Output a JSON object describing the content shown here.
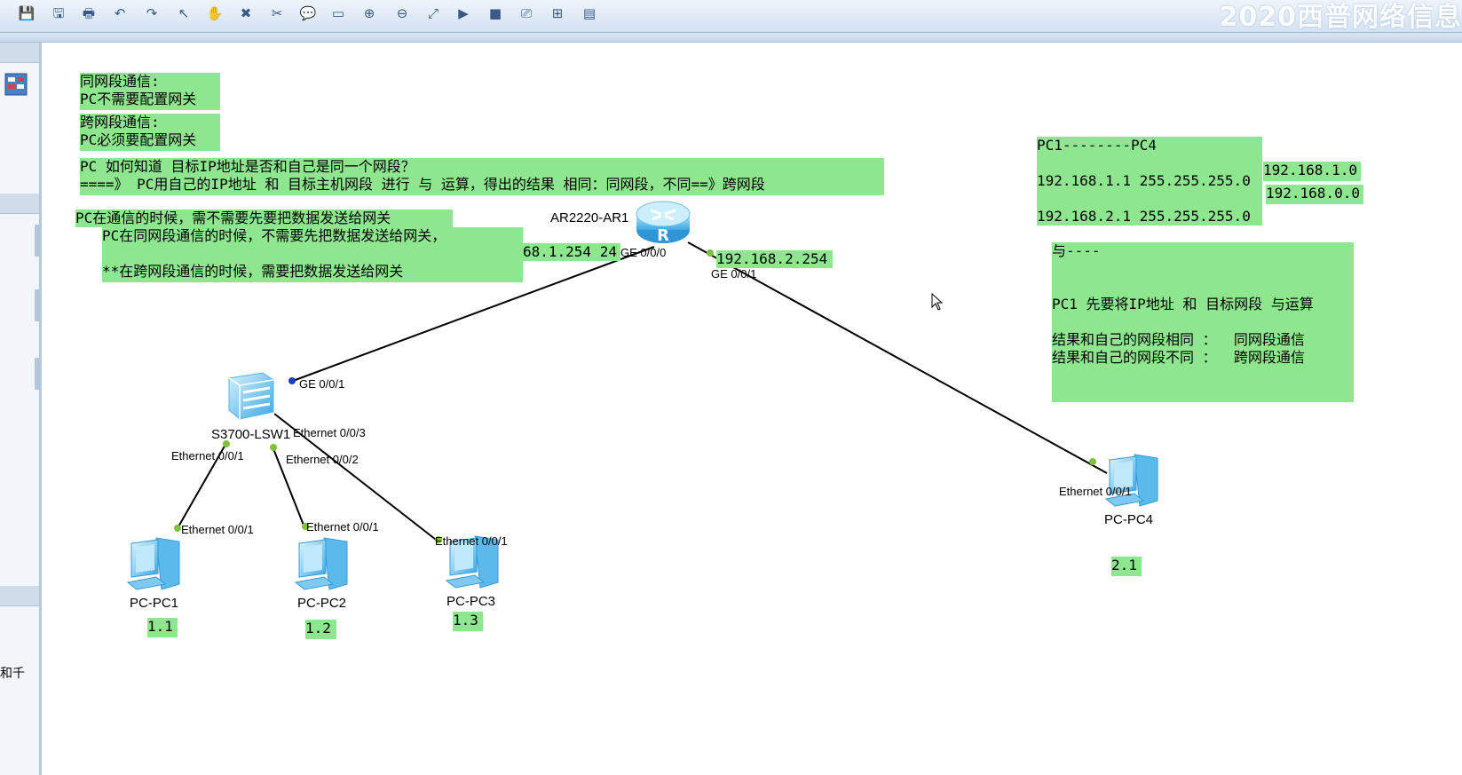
{
  "toolbar": {
    "icons": [
      "save-icon",
      "save-as-icon",
      "print-icon",
      "undo-icon",
      "redo-icon",
      "select-icon",
      "pan-icon",
      "delete-icon",
      "delete-link-icon",
      "text-note-icon",
      "rectangle-icon",
      "zoom-in-icon",
      "zoom-out-icon",
      "fit-icon",
      "start-icon",
      "stop-icon",
      "capture-icon",
      "topology-icon",
      "panel-icon",
      "screenshot-icon"
    ],
    "glyphs": [
      "💾",
      "🖫",
      "🖶",
      "↶",
      "↷",
      "↖",
      "✋",
      "✖",
      "✂",
      "💬",
      "▭",
      "⊕",
      "⊖",
      "⤢",
      "▶",
      "■",
      "⎚",
      "⊞",
      "▤",
      "▣"
    ],
    "brand": "2020西普网络信息"
  },
  "left_panel": {
    "text": "和千"
  },
  "notes": {
    "n1": "同网段通信:\nPC不需要配置网关",
    "n2": "跨网段通信:\nPC必须要配置网关",
    "n3": "PC 如何知道 目标IP地址是否和自己是同一个网段？\n====》 PC用自己的IP地址 和 目标主机网段 进行 与 运算，得出的结果 相同：同网段，不同==》跨网段",
    "n4": "PC在通信的时候，需不需要先要把数据发送给网关",
    "n5": "PC在同网段通信的时候，不需要先把数据发送给网关，\n\n**在跨网段通信的时候，需要把数据发送给网关",
    "n6": "68.1.254 24",
    "n7": "192.168.2.254",
    "n8": "PC1--------PC4\n\n192.168.1.1 255.255.255.0\n\n192.168.2.1 255.255.255.0",
    "n9": "192.168.1.0",
    "n10": "192.168.0.0",
    "n11": "与----\n\n\nPC1 先要将IP地址 和 目标网段 与运算\n\n结果和自己的网段相同 ：  同网段通信\n结果和自己的网段不同 ：  跨网段通信",
    "n12": "1.1",
    "n13": "1.2",
    "n14": "1.3",
    "n15": "2.1"
  },
  "devices": {
    "router": "AR2220-AR1",
    "switch": "S3700-LSW1",
    "pc1": "PC-PC1",
    "pc2": "PC-PC2",
    "pc3": "PC-PC3",
    "pc4": "PC-PC4"
  },
  "ports": {
    "r_ge000": "GE 0/0/0",
    "r_ge001": "GE 0/0/1",
    "sw_ge001": "GE 0/0/1",
    "sw_e001": "Ethernet 0/0/1",
    "sw_e002": "Ethernet 0/0/2",
    "sw_e003": "Ethernet 0/0/3",
    "pc1_e": "Ethernet 0/0/1",
    "pc2_e": "Ethernet 0/0/1",
    "pc3_e": "Ethernet 0/0/1",
    "pc4_e": "Ethernet 0/0/1"
  },
  "colors": {
    "note_green": "#8ee68e",
    "link_dot": "#7dc23a",
    "link_dot_blue": "#1a3ccc"
  }
}
